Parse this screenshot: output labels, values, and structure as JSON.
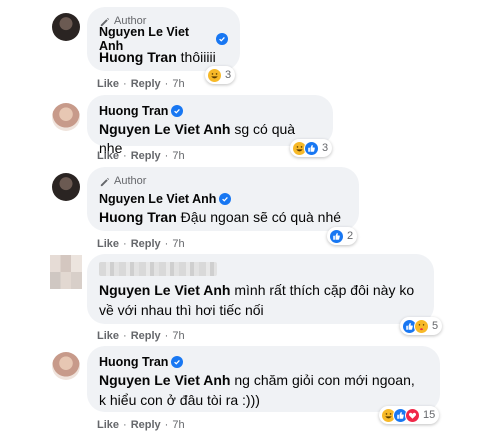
{
  "comments": [
    {
      "author_tag": "Author",
      "name": "Nguyen Le Viet Anh",
      "mention": "Huong Tran",
      "text": " thôiiiii",
      "actions": {
        "like": "Like",
        "reply": "Reply",
        "time": "7h"
      },
      "reactions": {
        "icons": [
          "haha-icon"
        ],
        "count": "3"
      }
    },
    {
      "name": "Huong Tran",
      "mention": "Nguyen Le Viet Anh",
      "text": " sg có quà nhe",
      "actions": {
        "like": "Like",
        "reply": "Reply",
        "time": "7h"
      },
      "reactions": {
        "icons": [
          "haha-icon",
          "like-icon"
        ],
        "count": "3"
      }
    },
    {
      "author_tag": "Author",
      "name": "Nguyen Le Viet Anh",
      "mention": "Huong Tran",
      "text": " Đậu ngoan sẽ có quà nhé",
      "actions": {
        "like": "Like",
        "reply": "Reply",
        "time": "7h"
      },
      "reactions": {
        "icons": [
          "like-icon"
        ],
        "count": "2"
      }
    },
    {
      "mention": "Nguyen Le Viet Anh",
      "text_line1": " mình rất thích cặp đôi này ko",
      "text_line2": "về với nhau thì hơi tiếc nối",
      "actions": {
        "like": "Like",
        "reply": "Reply",
        "time": "7h"
      },
      "reactions": {
        "icons": [
          "like-icon",
          "care-icon"
        ],
        "count": "5"
      }
    },
    {
      "name": "Huong Tran",
      "mention": "Nguyen Le Viet Anh",
      "text_line1": " ng chăm giỏi con mới ngoan,",
      "text_line2": "k hiểu con ở đâu tòi ra :)))",
      "actions": {
        "like": "Like",
        "reply": "Reply",
        "time": "7h"
      },
      "reactions": {
        "icons": [
          "haha-icon",
          "like-icon",
          "love-icon"
        ],
        "count": "15"
      }
    }
  ],
  "colors": {
    "bubble": "#f0f2f5",
    "verified": "#1877f2",
    "meta": "#65676b"
  }
}
